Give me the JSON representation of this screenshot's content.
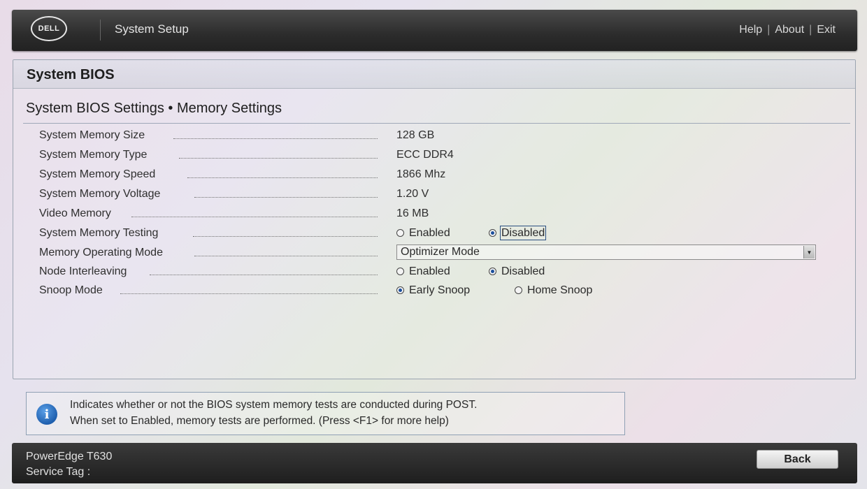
{
  "header": {
    "logo_text": "DELL",
    "app_title": "System Setup",
    "links": {
      "help": "Help",
      "about": "About",
      "exit": "Exit",
      "separator": "|"
    }
  },
  "panel": {
    "title": "System BIOS",
    "section_title": "System BIOS Settings • Memory Settings"
  },
  "settings": {
    "memory_size": {
      "label": "System Memory Size",
      "value": "128 GB"
    },
    "memory_type": {
      "label": "System Memory Type",
      "value": "ECC DDR4"
    },
    "memory_speed": {
      "label": "System Memory Speed",
      "value": "1866 Mhz"
    },
    "memory_voltage": {
      "label": "System Memory Voltage",
      "value": "1.20 V"
    },
    "video_memory": {
      "label": "Video Memory",
      "value": "16 MB"
    },
    "memory_testing": {
      "label": "System Memory Testing",
      "options": [
        "Enabled",
        "Disabled"
      ],
      "selected": "Disabled"
    },
    "operating_mode": {
      "label": "Memory Operating Mode",
      "value": "Optimizer Mode"
    },
    "node_interleaving": {
      "label": "Node Interleaving",
      "options": [
        "Enabled",
        "Disabled"
      ],
      "selected": "Disabled"
    },
    "snoop_mode": {
      "label": "Snoop Mode",
      "options": [
        "Early Snoop",
        "Home Snoop"
      ],
      "selected": "Early Snoop"
    }
  },
  "help": {
    "line1": "Indicates whether or not the BIOS system memory tests are conducted during POST.",
    "line2": "When set to Enabled, memory tests are performed. (Press <F1> for more help)"
  },
  "footer": {
    "model": "PowerEdge T630",
    "service_tag": "Service Tag :",
    "back_label": "Back"
  },
  "icons": {
    "info": "info-icon",
    "dropdown": "chevron-down-icon",
    "radio": "radio-icon"
  },
  "colors": {
    "bar_dark": "#2c2c2c",
    "accent_blue": "#1f5fae",
    "radio_selected": "#1b4f9c"
  }
}
